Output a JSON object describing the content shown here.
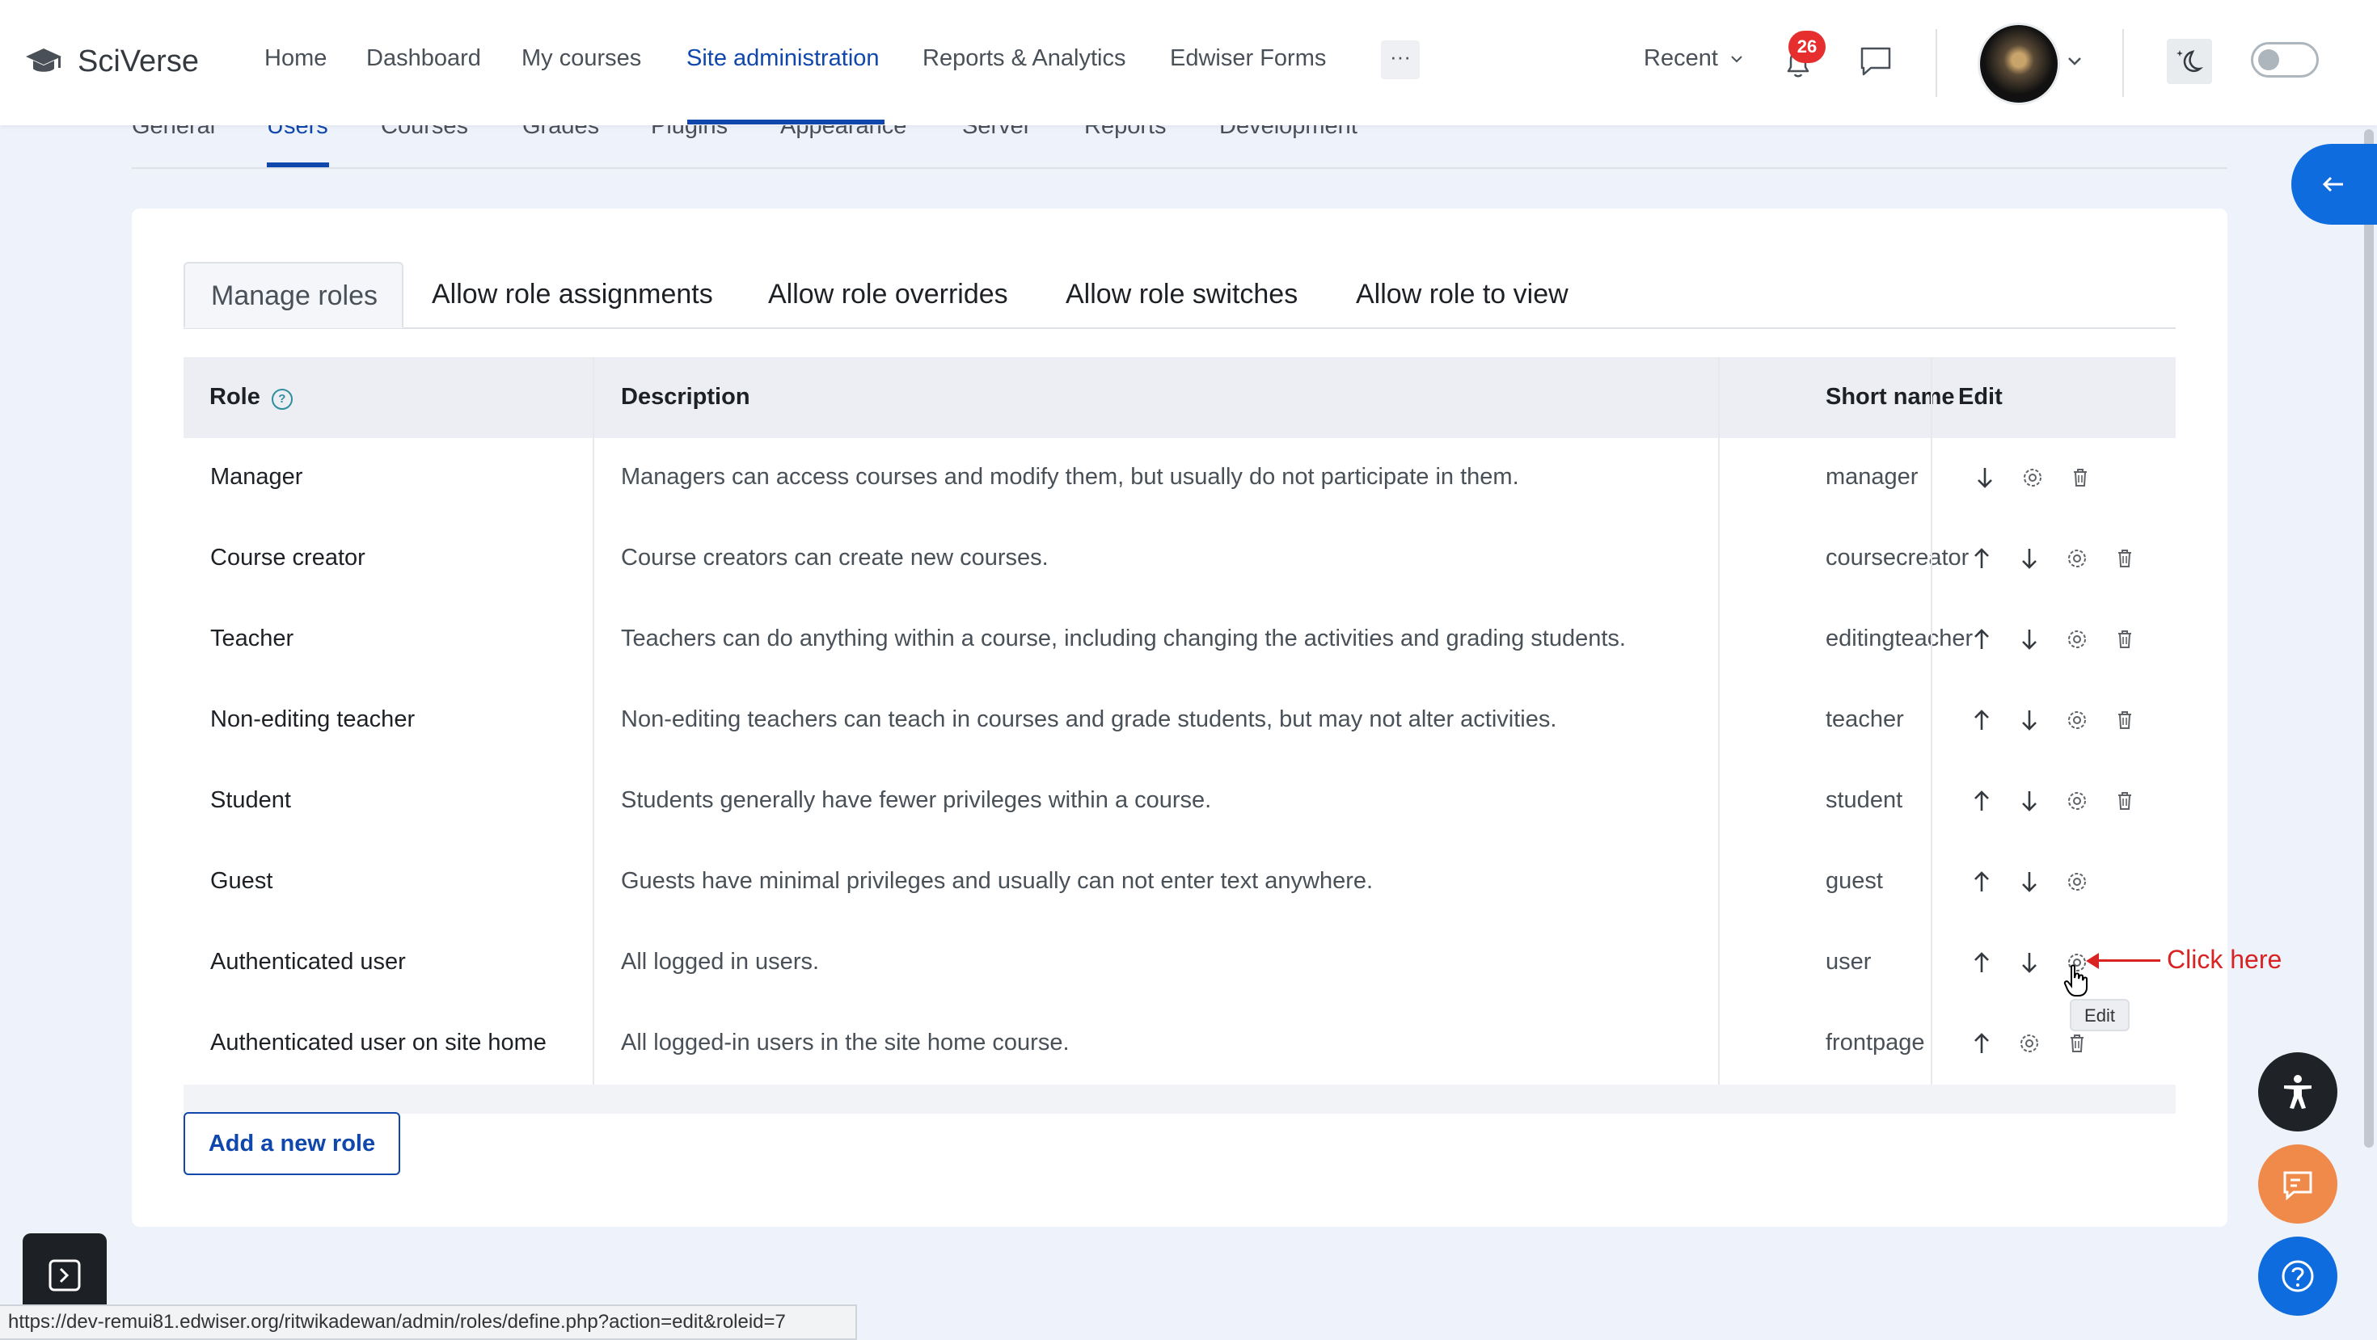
{
  "brand": {
    "name": "SciVerse"
  },
  "nav": {
    "links": [
      "Home",
      "Dashboard",
      "My courses",
      "Site administration",
      "Reports & Analytics",
      "Edwiser Forms"
    ],
    "more": "···",
    "recent": "Recent",
    "notification_count": "26"
  },
  "admin_tabs": [
    "General",
    "Users",
    "Courses",
    "Grades",
    "Plugins",
    "Appearance",
    "Server",
    "Reports",
    "Development"
  ],
  "role_tabs": [
    "Manage roles",
    "Allow role assignments",
    "Allow role overrides",
    "Allow role switches",
    "Allow role to view"
  ],
  "table": {
    "headers": {
      "role": "Role",
      "description": "Description",
      "short_name": "Short name",
      "edit": "Edit"
    },
    "rows": [
      {
        "role": "Manager",
        "description": "Managers can access courses and modify them, but usually do not participate in them.",
        "short": "manager"
      },
      {
        "role": "Course creator",
        "description": "Course creators can create new courses.",
        "short": "coursecreator"
      },
      {
        "role": "Teacher",
        "description": "Teachers can do anything within a course, including changing the activities and grading students.",
        "short": "editingteacher"
      },
      {
        "role": "Non-editing teacher",
        "description": "Non-editing teachers can teach in courses and grade students, but may not alter activities.",
        "short": "teacher"
      },
      {
        "role": "Student",
        "description": "Students generally have fewer privileges within a course.",
        "short": "student"
      },
      {
        "role": "Guest",
        "description": "Guests have minimal privileges and usually can not enter text anywhere.",
        "short": "guest"
      },
      {
        "role": "Authenticated user",
        "description": "All logged in users.",
        "short": "user"
      },
      {
        "role": "Authenticated user on site home",
        "description": "All logged-in users in the site home course.",
        "short": "frontpage"
      }
    ]
  },
  "add_role_button": "Add a new role",
  "annotation": {
    "text": "Click here",
    "tooltip": "Edit"
  },
  "status_url": "https://dev-remui81.edwiser.org/ritwikadewan/admin/roles/define.php?action=edit&roleid=7",
  "colors": {
    "primary": "#0f47ad",
    "annotation": "#d92323",
    "badge": "#e62e2e",
    "feedback": "#f08a4b"
  },
  "icons": [
    "graduation-cap-icon",
    "bell-icon",
    "chat-icon",
    "moon-icon",
    "arrow-up-icon",
    "arrow-down-icon",
    "gear-icon",
    "trash-icon",
    "accessibility-icon",
    "feedback-icon",
    "help-icon",
    "arrow-left-icon"
  ]
}
